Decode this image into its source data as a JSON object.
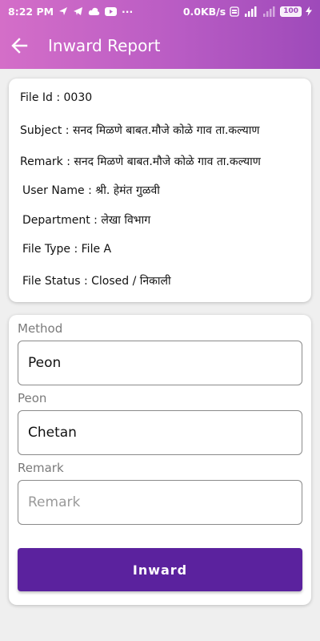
{
  "status_bar": {
    "time": "8:22 PM",
    "more": "···",
    "network_speed": "0.0KB/s",
    "battery": "100"
  },
  "app_bar": {
    "title": "Inward Report",
    "back_icon": "arrow-left-icon",
    "background_color": "#b95cc4"
  },
  "file_info": {
    "file_id": "File Id   : 0030",
    "subject": "Subject : सनद मिळणे बाबत.मौजे कोळे गाव ता.कल्याण",
    "remark": "Remark : सनद मिळणे बाबत.मौजे कोळे गाव ता.कल्याण",
    "user_name": "User Name  : श्री. हेमंत गुळवी",
    "department": "Department : लेखा विभाग",
    "file_type": "File Type       : File A",
    "file_status": "File Status    : Closed / निकाली"
  },
  "form": {
    "method_label": "Method",
    "method_value": "Peon",
    "peon_label": "Peon",
    "peon_value": "Chetan",
    "remark_label": "Remark",
    "remark_placeholder": "Remark",
    "submit_label": "Inward",
    "button_color": "#5b229e"
  }
}
